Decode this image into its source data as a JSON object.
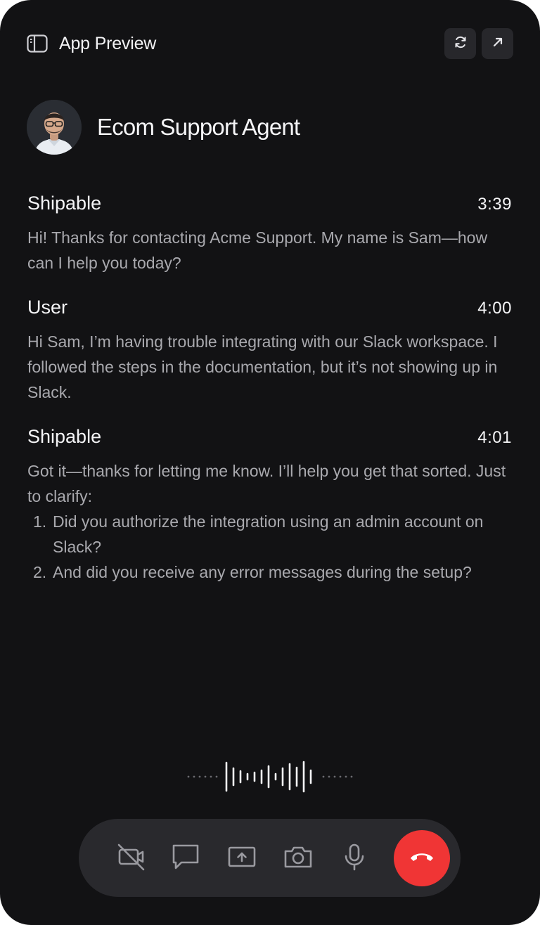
{
  "header": {
    "title": "App Preview",
    "sidebar_icon": "sidebar-toggle-icon",
    "refresh_icon": "refresh-icon",
    "open_external_icon": "arrow-up-right-icon"
  },
  "agent": {
    "name": "Ecom Support Agent",
    "avatar": "agent-avatar"
  },
  "messages": [
    {
      "sender": "Shipable",
      "time": "3:39",
      "text": "Hi! Thanks for contacting Acme Support. My name is Sam—how can I help you today?"
    },
    {
      "sender": "User",
      "time": "4:00",
      "text": "Hi Sam, I’m having trouble integrating with our Slack workspace. I followed the steps in the documentation, but it’s not showing up in Slack."
    },
    {
      "sender": "Shipable",
      "time": "4:01",
      "text": "Got it—thanks for letting me know. I’ll help you get that sorted. Just to clarify:",
      "list": [
        {
          "num": "1.",
          "text": "Did you authorize the integration using an admin account on Slack?"
        },
        {
          "num": "2.",
          "text": "And did you receive any error messages during the setup?"
        }
      ]
    }
  ],
  "controls": {
    "camera_off_icon": "video-off-icon",
    "chat_icon": "chat-bubble-icon",
    "share_screen_icon": "screen-share-icon",
    "photo_icon": "camera-icon",
    "mic_icon": "microphone-icon",
    "end_call_icon": "phone-hangup-icon"
  },
  "colors": {
    "background": "#121214",
    "surface": "#29292d",
    "text_primary": "#f4f4f6",
    "text_secondary": "#a9a9ae",
    "end_call": "#f03535"
  }
}
